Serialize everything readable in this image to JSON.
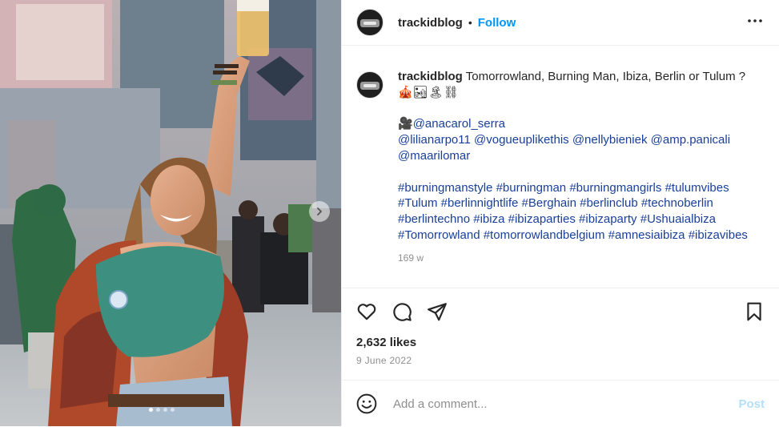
{
  "post": {
    "username": "trackidblog",
    "separator": "•",
    "follow_label": "Follow",
    "more_label": "•••"
  },
  "caption": {
    "username": "trackidblog",
    "title_text": "Tomorrowland, Burning Man, Ibiza, Berlin or Tulum ?",
    "title_emojis": "🎪🏜🏝⛓",
    "camera_emoji": "🎥",
    "credit_mention": "@anacarol_serra",
    "mentions": [
      "@lilianarpo11",
      "@vogueuplikethis",
      "@nellybieniek",
      "@amp.panicali",
      "@maarilomar"
    ],
    "hashtags": [
      "#burningmanstyle",
      "#burningman",
      "#burningmangirls",
      "#tulumvibes",
      "#Tulum",
      "#berlinnightlife",
      "#Berghain",
      "#berlinclub",
      "#technoberlin",
      "#berlintechno",
      "#ibiza",
      "#ibizaparties",
      "#ibizaparty",
      "#Ushuaialbiza",
      "#Tomorrowland",
      "#tomorrowlandbelgium",
      "#amnesiaibiza",
      "#ibizavibes"
    ],
    "time_ago": "169 w"
  },
  "stats": {
    "likes": "2,632 likes",
    "date": "9 June 2022"
  },
  "comment": {
    "placeholder": "Add a comment...",
    "post_label": "Post"
  },
  "carousel": {
    "total_slides": 4,
    "active_slide": 1
  },
  "colors": {
    "accent": "#0095f6",
    "link": "#00376b",
    "post_disabled": "#b2dffc",
    "muted": "#8e8e8e"
  },
  "icons": [
    "heart-icon",
    "comment-icon",
    "share-icon",
    "bookmark-icon",
    "emoji-icon",
    "chevron-right-icon"
  ]
}
